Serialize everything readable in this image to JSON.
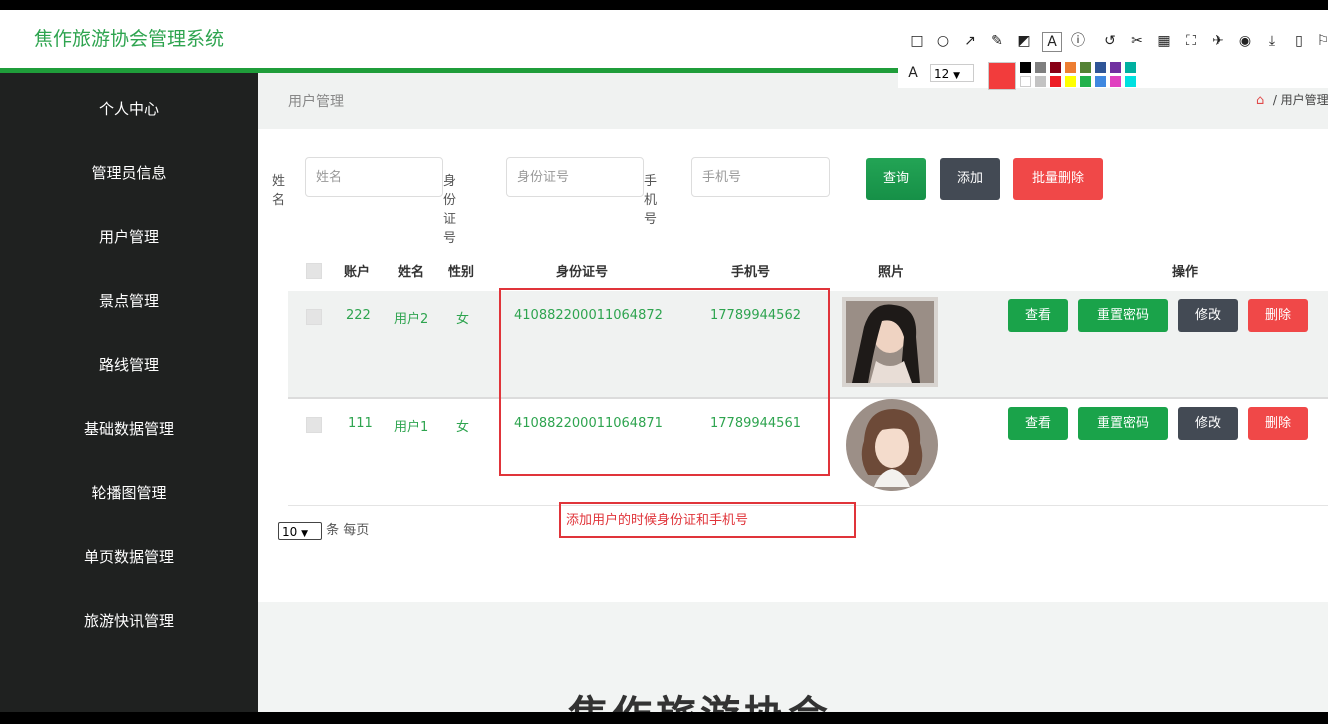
{
  "app": {
    "title": "焦作旅游协会管理系统"
  },
  "sidebar": {
    "items": [
      {
        "label": "个人中心"
      },
      {
        "label": "管理员信息"
      },
      {
        "label": "用户管理"
      },
      {
        "label": "景点管理"
      },
      {
        "label": "路线管理"
      },
      {
        "label": "基础数据管理"
      },
      {
        "label": "轮播图管理"
      },
      {
        "label": "单页数据管理"
      },
      {
        "label": "旅游快讯管理"
      }
    ]
  },
  "page": {
    "title": "用户管理",
    "breadcrumb": "/ 用户管理"
  },
  "search": {
    "name_label": "姓名",
    "name_placeholder": "姓名",
    "id_label": "身份证号",
    "id_placeholder": "身份证号",
    "phone_label": "手机号",
    "phone_placeholder": "手机号",
    "query_label": "查询",
    "add_label": "添加",
    "batch_delete_label": "批量删除"
  },
  "table": {
    "headers": [
      "账户",
      "姓名",
      "性别",
      "身份证号",
      "手机号",
      "照片",
      "操作"
    ],
    "rows": [
      {
        "account": "222",
        "name": "用户2",
        "gender": "女",
        "id_number": "410882200011064872",
        "phone": "17789944562"
      },
      {
        "account": "111",
        "name": "用户1",
        "gender": "女",
        "id_number": "410882200011064871",
        "phone": "17789944561"
      }
    ],
    "actions": {
      "view": "查看",
      "reset": "重置密码",
      "edit": "修改",
      "delete": "删除"
    }
  },
  "pager": {
    "size": "10",
    "suffix": "条 每页"
  },
  "annotation": {
    "text": "添加用户的时候身份证和手机号"
  },
  "toolbar": {
    "font_size": "12"
  },
  "colors": {
    "green": "#2ea44f",
    "dark": "#1f2120",
    "red": "#f04848",
    "slate": "#434a54",
    "annotation": "#e0343a"
  },
  "bottom": {
    "text": "焦作旅游协会"
  }
}
